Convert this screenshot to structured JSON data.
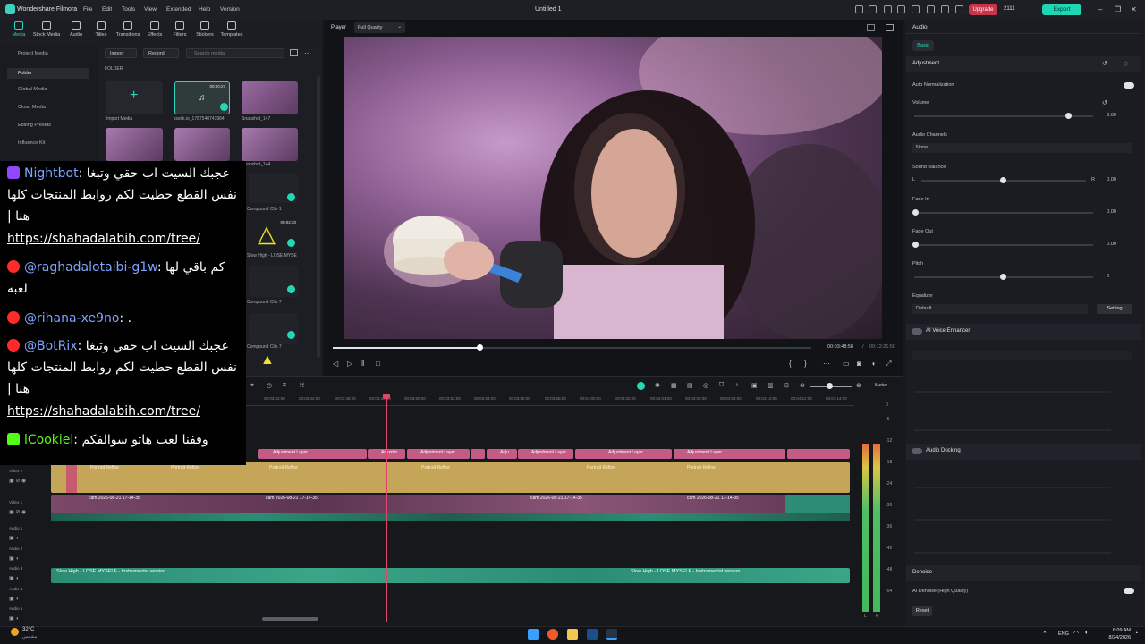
{
  "app": {
    "name": "Wondershare Filmora",
    "menu": [
      "File",
      "Edit",
      "Tools",
      "View",
      "Extended",
      "Help",
      "Version"
    ],
    "doc_title": "Untitled 1",
    "upgrade": "Upgrade",
    "credits": "2111",
    "export": "Export"
  },
  "toolbar": {
    "items": [
      {
        "label": "Media",
        "icon": "media-icon"
      },
      {
        "label": "Stock Media",
        "icon": "stock-media-icon"
      },
      {
        "label": "Audio",
        "icon": "audio-icon"
      },
      {
        "label": "Titles",
        "icon": "titles-icon"
      },
      {
        "label": "Transitions",
        "icon": "transitions-icon"
      },
      {
        "label": "Effects",
        "icon": "effects-icon"
      },
      {
        "label": "Filters",
        "icon": "filters-icon"
      },
      {
        "label": "Stickers",
        "icon": "stickers-icon"
      },
      {
        "label": "Templates",
        "icon": "templates-icon"
      }
    ]
  },
  "leftnav": {
    "items": [
      "Project Media",
      "Folder",
      "Global Media",
      "Cloud Media",
      "Editing Presets",
      "Influence Kit"
    ]
  },
  "media": {
    "import": "Import",
    "record": "Record",
    "search_placeholder": "Search media",
    "folder": "FOLDER",
    "import_media": "Import Media",
    "items": [
      {
        "name": "ssstik.io_1787540743984",
        "duration": "00:00:27"
      },
      {
        "name": "Snapshot_147"
      },
      {
        "name": "Snapshot_144"
      },
      {
        "name": "Compound Clip 1"
      },
      {
        "name": "Slow High - LOSE MYSE",
        "duration": "00:02:20"
      },
      {
        "name": "Compound Clip 7"
      },
      {
        "name": "Compound Clip 7"
      }
    ]
  },
  "player": {
    "label": "Player",
    "quality": "Full Quality",
    "current_time": "00:03:48:58",
    "total_time": "00:12:21:50",
    "progress": 0.31
  },
  "right_panel": {
    "tab": "Audio",
    "subtab": "Basic",
    "adjustment": "Adjustment",
    "auto_normalization": "Auto Normalization",
    "volume": {
      "label": "Volume",
      "value": "6.00"
    },
    "audio_channels": {
      "label": "Audio Channels",
      "value": "None"
    },
    "sound_balance": {
      "label": "Sound Balance",
      "l": "L",
      "r": "R",
      "value": "0.00"
    },
    "fade_in": {
      "label": "Fade In",
      "value": "0.00"
    },
    "fade_out": {
      "label": "Fade Out",
      "value": "0.00"
    },
    "pitch": {
      "label": "Pitch",
      "value": "0"
    },
    "equalizer": {
      "label": "Equalizer",
      "value": "Default",
      "button": "Setting"
    },
    "ai_voice_enhancer": "AI Voice Enhancer",
    "audio_ducking": "Audio Ducking",
    "denoise": "Denoise",
    "ai_denoise": "AI Denoise (High Quality)",
    "reset": "Reset"
  },
  "timeline": {
    "meter": "Meter",
    "ruler": [
      "00:03:42:00",
      "00:03:44:00",
      "00:03:46:00",
      "00:03:48:00",
      "00:03:50:00",
      "00:03:52:00",
      "00:03:54:00",
      "00:03:56:00",
      "00:03:58:00",
      "00:04:00:00",
      "00:04:02:00",
      "00:04:04:00",
      "00:04:06:00",
      "00:04:08:00",
      "00:04:10:00",
      "00:04:12:00",
      "00:04:14:00"
    ],
    "tracks": [
      "Video 2",
      "Video 1",
      "Audio 1",
      "Audio 2",
      "Audio 3",
      "Audio 4",
      "Audio 5"
    ],
    "adjustment_clip": "Adjustment Layer",
    "portrait_clip": "Portrait Refine",
    "cam_clip": "cam 2026-08-21 17-14-35",
    "music_clip": "Slow High - LOSE MYSELF - Instrumental version",
    "meter_scale": [
      "0",
      "-6",
      "-12",
      "-18",
      "-24",
      "-30",
      "-36",
      "-42",
      "-48",
      "-54"
    ],
    "meter_lr": [
      "L",
      "R"
    ]
  },
  "chat": [
    {
      "platform": "twitch",
      "user": "Nightbot",
      "text": "عجبك السيت اب حقي وتبغا نفس القطع حطيت لكم روابط المنتجات كلها هنا |",
      "link": "https://shahadalabih.com/tree/"
    },
    {
      "platform": "youtube",
      "user": "@raghadalotaibi-g1w",
      "text": "كم باقي لها لعبه"
    },
    {
      "platform": "youtube",
      "user": "@rihana-xe9no",
      "text": "."
    },
    {
      "platform": "youtube",
      "user": "@BotRix",
      "text": "عجبك السيت اب حقي وتبغا نفس القطع حطيت لكم روابط المنتجات كلها هنا |",
      "link": "https://shahadalabih.com/tree/"
    },
    {
      "platform": "kick",
      "user": "lCookiel",
      "text": "وقفنا لعب هاتو سوالفكم"
    }
  ],
  "taskbar": {
    "temp": "32°C",
    "weather": "مشمس",
    "lang": "ENG",
    "time": "6:09 AM",
    "date": "8/24/2026"
  },
  "colors": {
    "accent": "#2ad8bf",
    "adjustment": "#c45a86",
    "portrait": "#c5a558",
    "audio": "#2c8c74",
    "playhead": "#e0456a"
  }
}
